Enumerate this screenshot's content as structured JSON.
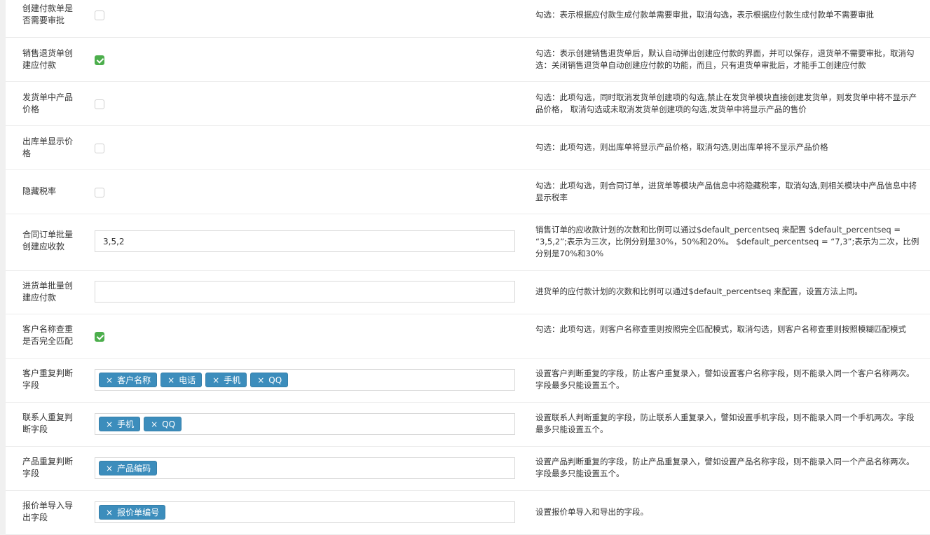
{
  "rows": [
    {
      "label": "创建付款单是否需要审批",
      "type": "checkbox",
      "checked": false,
      "desc": "勾选：表示根据应付款生成付款单需要审批，取消勾选，表示根据应付款生成付款单不需要审批"
    },
    {
      "label": "销售退货单创建应付款",
      "type": "checkbox",
      "checked": true,
      "desc": "勾选：表示创建销售退货单后，默认自动弹出创建应付款的界面，并可以保存，退货单不需要审批，取消勾选：关闭销售退货单自动创建应付款的功能，而且，只有退货单审批后，才能手工创建应付款"
    },
    {
      "label": "发货单中产品价格",
      "type": "checkbox",
      "checked": false,
      "desc": "勾选：此项勾选，同时取消发货单创建项的勾选,禁止在发货单模块直接创建发货单，则发货单中将不显示产品价格， 取消勾选或未取消发货单创建项的勾选,发货单中将显示产品的售价"
    },
    {
      "label": "出库单显示价格",
      "type": "checkbox",
      "checked": false,
      "desc": "勾选：此项勾选，则出库单将显示产品价格，取消勾选,则出库单将不显示产品价格"
    },
    {
      "label": "隐藏税率",
      "type": "checkbox",
      "checked": false,
      "desc": "勾选：此项勾选，则合同订单，进货单等模块产品信息中将隐藏税率，取消勾选,则相关模块中产品信息中将显示税率"
    },
    {
      "label": "合同订单批量创建应收款",
      "type": "text",
      "value": "3,5,2",
      "desc": "销售订单的应收款计划的次数和比例可以通过$default_percentseq 来配置 $default_percentseq = “3,5,2”;表示为三次，比例分别是30%，50%和20%。 $default_percentseq = “7,3”;表示为二次，比例分别是70%和30%"
    },
    {
      "label": "进货单批量创建应付款",
      "type": "text",
      "value": "",
      "desc": "进货单的应付款计划的次数和比例可以通过$default_percentseq 来配置，设置方法上同。"
    },
    {
      "label": "客户名称查重是否完全匹配",
      "type": "checkbox",
      "checked": true,
      "desc": "勾选：此项勾选，则客户名称查重则按照完全匹配模式，取消勾选，则客户名称查重则按照模糊匹配模式"
    },
    {
      "label": "客户重复判断字段",
      "type": "tags",
      "tags": [
        "客户名称",
        "电话",
        "手机",
        "QQ"
      ],
      "desc": "设置客户判断重复的字段，防止客户重复录入，譬如设置客户名称字段，则不能录入同一个客户名称两次。字段最多只能设置五个。"
    },
    {
      "label": "联系人重复判断字段",
      "type": "tags",
      "tags": [
        "手机",
        "QQ"
      ],
      "desc": "设置联系人判断重复的字段，防止联系人重复录入，譬如设置手机字段，则不能录入同一个手机两次。字段最多只能设置五个。"
    },
    {
      "label": "产品重复判断字段",
      "type": "tags",
      "tags": [
        "产品编码"
      ],
      "desc": "设置产品判断重复的字段，防止产品重复录入，譬如设置产品名称字段，则不能录入同一个产品名称两次。字段最多只能设置五个。"
    },
    {
      "label": "报价单导入导出字段",
      "type": "tags",
      "tags": [
        "报价单编号"
      ],
      "desc": "设置报价单导入和导出的字段。"
    }
  ],
  "tag_remove_glyph": "×",
  "colors": {
    "tag_bg": "#3c8dbc",
    "checkbox_on": "#4cae4c"
  }
}
